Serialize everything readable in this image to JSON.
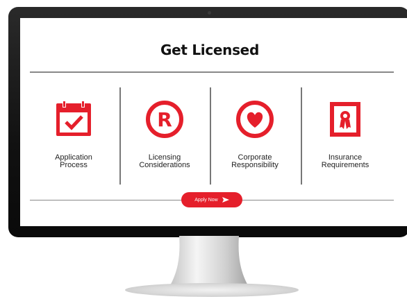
{
  "page": {
    "title": "Get Licensed",
    "items": [
      {
        "icon": "calendar-check-icon",
        "label": "Application\nProcess"
      },
      {
        "icon": "registered-trademark-icon",
        "label": "Licensing\nConsiderations"
      },
      {
        "icon": "heart-icon",
        "label": "Corporate\nResponsibility"
      },
      {
        "icon": "certificate-icon",
        "label": "Insurance\nRequirements"
      }
    ],
    "apply_label": "Apply Now",
    "accent_color": "#e51f2b"
  }
}
